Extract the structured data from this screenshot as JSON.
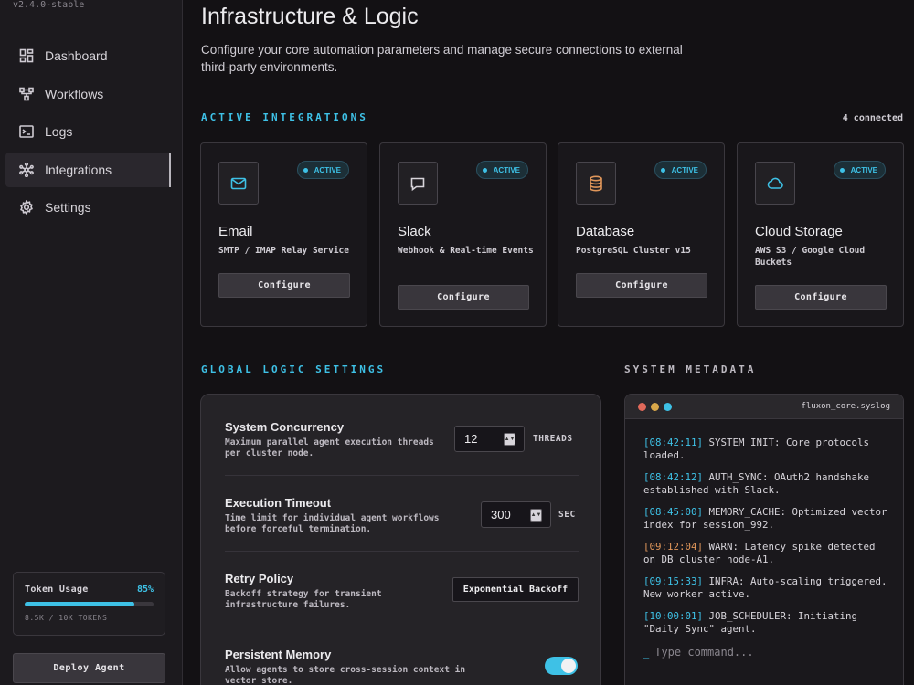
{
  "app": {
    "version": "v2.4.0-stable"
  },
  "sidebar": {
    "items": [
      {
        "label": "Dashboard",
        "icon": "dashboard-icon",
        "active": false
      },
      {
        "label": "Workflows",
        "icon": "workflow-icon",
        "active": false
      },
      {
        "label": "Logs",
        "icon": "terminal-icon",
        "active": false
      },
      {
        "label": "Integrations",
        "icon": "hub-icon",
        "active": true
      },
      {
        "label": "Settings",
        "icon": "gear-icon",
        "active": false
      }
    ],
    "usage": {
      "label": "Token Usage",
      "percent_label": "85%",
      "percent": 85,
      "detail": "8.5K / 10K TOKENS"
    },
    "deploy_label": "Deploy Agent"
  },
  "page": {
    "title": "Infrastructure & Logic",
    "description": "Configure your core automation parameters and manage secure connections to external third-party environments."
  },
  "integrations": {
    "heading": "ACTIVE INTEGRATIONS",
    "count_label": "4 connected",
    "cards": [
      {
        "name": "Email",
        "subtitle": "SMTP / IMAP Relay Service",
        "status": "ACTIVE",
        "button": "Configure",
        "icon": "mail-icon",
        "icon_color": "#3ec1e6"
      },
      {
        "name": "Slack",
        "subtitle": "Webhook & Real-time Events",
        "status": "ACTIVE",
        "button": "Configure",
        "icon": "chat-icon",
        "icon_color": "#d7d4da"
      },
      {
        "name": "Database",
        "subtitle": "PostgreSQL Cluster v15",
        "status": "ACTIVE",
        "button": "Configure",
        "icon": "database-icon",
        "icon_color": "#e0965a"
      },
      {
        "name": "Cloud Storage",
        "subtitle": "AWS S3 / Google Cloud Buckets",
        "status": "ACTIVE",
        "button": "Configure",
        "icon": "cloud-icon",
        "icon_color": "#3ec1e6"
      }
    ]
  },
  "global_settings": {
    "heading": "GLOBAL LOGIC SETTINGS",
    "concurrency": {
      "title": "System Concurrency",
      "desc": "Maximum parallel agent execution threads per cluster node.",
      "value": "12",
      "unit": "THREADS"
    },
    "timeout": {
      "title": "Execution Timeout",
      "desc": "Time limit for individual agent workflows before forceful termination.",
      "value": "300",
      "unit": "SEC"
    },
    "retry": {
      "title": "Retry Policy",
      "desc": "Backoff strategy for transient infrastructure failures.",
      "value": "Exponential Backoff"
    },
    "memory": {
      "title": "Persistent Memory",
      "desc": "Allow agents to store cross-session context in vector store.",
      "enabled": true
    }
  },
  "metadata": {
    "heading": "SYSTEM METADATA",
    "filename": "fluxon_core.syslog",
    "log": [
      {
        "ts": "[08:42:11]",
        "msg": "SYSTEM_INIT: Core protocols loaded.",
        "level": "info"
      },
      {
        "ts": "[08:42:12]",
        "msg": "AUTH_SYNC: OAuth2 handshake established with Slack.",
        "level": "info"
      },
      {
        "ts": "[08:45:00]",
        "msg": "MEMORY_CACHE: Optimized vector index for session_992.",
        "level": "info"
      },
      {
        "ts": "[09:12:04]",
        "msg": "WARN: Latency spike detected on DB cluster node-A1.",
        "level": "warn"
      },
      {
        "ts": "[09:15:33]",
        "msg": "INFRA: Auto-scaling triggered. New worker active.",
        "level": "info"
      },
      {
        "ts": "[10:00:01]",
        "msg": "JOB_SCHEDULER: Initiating \"Daily Sync\" agent.",
        "level": "info"
      }
    ],
    "prompt_placeholder": "Type command...",
    "dot_colors": [
      "#e0695a",
      "#d9a84a",
      "#3ec1e6"
    ]
  }
}
